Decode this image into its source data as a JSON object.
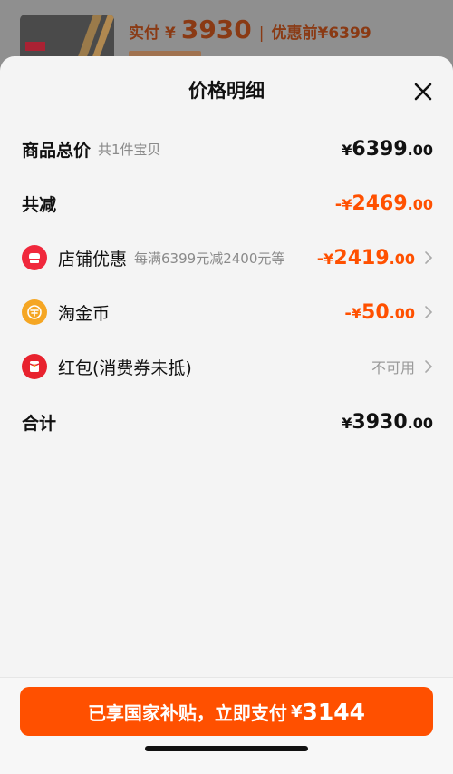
{
  "background": {
    "paid_label": "实付",
    "paid_currency": "¥",
    "paid_value": "3930",
    "separator": "|",
    "before_label": "优惠前¥6399"
  },
  "sheet": {
    "title": "价格明细"
  },
  "rows": {
    "total": {
      "label": "商品总价",
      "sub": "共1件宝贝",
      "currency": "¥",
      "int": "6399",
      "dec": ".00"
    },
    "reduce": {
      "label": "共减",
      "sign": "-",
      "currency": "¥",
      "int": "2469",
      "dec": ".00"
    },
    "shop": {
      "label": "店铺优惠",
      "sub": "每满6399元减2400元等",
      "sign": "-",
      "currency": "¥",
      "int": "2419",
      "dec": ".00"
    },
    "coin": {
      "label": "淘金币",
      "sign": "-",
      "currency": "¥",
      "int": "50",
      "dec": ".00"
    },
    "redpacket": {
      "label": "红包(消费券未抵)",
      "status": "不可用"
    },
    "sum": {
      "label": "合计",
      "currency": "¥",
      "int": "3930",
      "dec": ".00"
    }
  },
  "footer": {
    "button_text": "已享国家补贴，立即支付",
    "button_currency": "¥",
    "button_value": "3144"
  },
  "colors": {
    "accent": "#ff5000",
    "shop_icon": "#f0283c",
    "coin_icon": "#f5a623",
    "redpacket_icon": "#e8222e"
  },
  "icons": {
    "shop": "shop-icon",
    "coin": "coin-icon",
    "redpacket": "red-packet-icon",
    "close": "close-icon",
    "chevron": "chevron-right-icon"
  }
}
